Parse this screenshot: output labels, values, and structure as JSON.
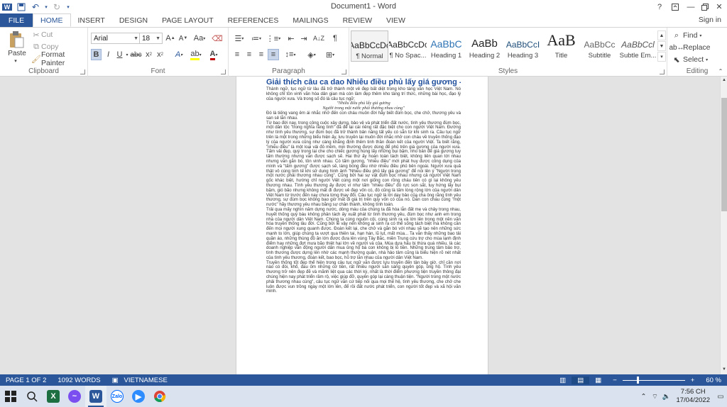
{
  "app": {
    "title": "Document1 - Word",
    "signin": "Sign in"
  },
  "tabs": [
    "FILE",
    "HOME",
    "INSERT",
    "DESIGN",
    "PAGE LAYOUT",
    "REFERENCES",
    "MAILINGS",
    "REVIEW",
    "VIEW"
  ],
  "clipboard": {
    "paste": "Paste",
    "cut": "Cut",
    "copy": "Copy",
    "format_painter": "Format Painter",
    "label": "Clipboard"
  },
  "font": {
    "name": "Arial",
    "size": "18",
    "label": "Font"
  },
  "paragraph": {
    "label": "Paragraph"
  },
  "styles": {
    "label": "Styles",
    "items": [
      {
        "preview": "AaBbCcDc",
        "name": "¶ Normal"
      },
      {
        "preview": "AaBbCcDc",
        "name": "¶ No Spac..."
      },
      {
        "preview": "AaBbC",
        "name": "Heading 1"
      },
      {
        "preview": "AaBb",
        "name": "Heading 2"
      },
      {
        "preview": "AaBbCcI",
        "name": "Heading 3"
      },
      {
        "preview": "AaB",
        "name": "Title"
      },
      {
        "preview": "AaBbCc",
        "name": "Subtitle"
      },
      {
        "preview": "AaBbCcl",
        "name": "Subtle Em..."
      }
    ]
  },
  "editing": {
    "find": "Find",
    "replace": "Replace",
    "select": "Select",
    "label": "Editing"
  },
  "document": {
    "heading": "Giải thích câu ca dao Nhiễu điều phủ lấy giá gương -",
    "intro": "Thành ngữ, tục ngữ từ lâu đã trở thành một vẻ đẹp bất diệt trong kho tàng văn học Việt Nam. Nó không chỉ tồn vinh văn hóa dân gian mà còn làm đẹp thêm kho tàng trí thức, những bài học, đạo lý của người xưa. Và trong số đó là câu tục ngữ:",
    "poem1": "\"Nhiễu điều phủ lấy giá gương",
    "poem2": "Người trong một nước phải thương nhau cùng\"",
    "p1": "Đó là tiếng vang êm ái nhắc nhở đến con cháu muôn đời hãy biết đùm bọc, che chở, thương yêu và san sẻ lẫn nhau.",
    "p2": "Từ bao đời nay, trong công cuộc xây dựng, bảo vệ và phát triển đất nước, tình yêu thương đùm bọc, một dân tộc \"trong nghĩa rằng tình\" đã để lại cái riêng rất đặc biệt cho con người Việt Nam. Đường như tình yêu thương, sự đùm bọc đã trở thành bản năng tất yếu có sẵn từ khi sinh ra. Câu tục ngữ trên là một trong những biểu hiện ấy, lưu truyền lại muôn đời nhắc nhở con cháu về truyền thống đạo lý của người xưa cũng như càng khẳng định thêm tinh thần đoàn kết của người Việt. Ta biết rằng, \"nhiễu điều\" là một loại vải đỏ mềm, mịn thường được dùng để phủ trên giá gương của người xưa. Tấm vải đẹp, quý trong lại che cho chiếc gương hùng lấy những bụi bặm, nho bản để giá gương tuy tấm thường nhưng vẫn được sạch sẽ. Hai thứ ấy hoàn toàn tách biệt, không liên quan tới nhau nhưng vẫn gắn bó, tôn vinh nhau. Có tấm gương, \"nhiễu điều\" mới phát huy được công dụng của mình và \"tấm gương\" được sạch sẽ, láng bóng đều nhờ nhiễu điều phủ bên ngoài. Người xưa quả thật vô cùng tinh tế khi sử dụng hình ảnh \"Nhiễu điều phủ lấy giá gương\" để nói lên ý \"Người trong một nước phải thương nhau cùng\". Cũng bởi hai sự vật đùm bọc nhau nhưng cả người Việt Nam gốc khác biệt, hướng chỉ người Việt cùng một nơi giống con rồng cháu tiên có gì lại không yêu thương nhau. Tình yêu thương ấy được ví như tấm \"nhiễu điều\" đỏ rực son sắt, tuy hứng lấy bụi bặm, gió bão nhưng không mất đi được vẻ đẹp vốn có, đó cũng là tấm lòng rộng lớn của người dân Việt Nam từ trước đến nay chưa từng thay đổi. Câu tục ngữ là lời dạy bảo của cha ông rằng tình yêu thương, sự đùm bọc không bao giờ mất đi giá trị trên quy vốn có của nó. Dẫn con cháu cùng \"một nước\" hãy thương yêu nhau bằng sự chân thành, không tính toán.",
    "p3": "Trải qua mấy nghìn năm dựng nước, dòng máu của chúng ta đã hòa lẫn đất mẹ và chảy trong nhau, huyết thống quý báu không phân tách ấy xuất phát từ tình thương yêu, đùm bọc như anh em trong nhà của người dân Việt Nam. Chúng ta cùng nguồn cội, cùng sinh ra và lớn lên trong một nền văn hóa truyền thống lâu đời. Cũng bởi lẽ vậy nên không ai sinh ra có thể sống tách biệt mà không cần đến mọi người xung quanh được. Đoàn kết lại, che chở và gắn bó với nhau sẽ tạo nên những sức mạnh to lớn, giúp chúng ta vượt qua thiên tai, hạn hán, lũ lụt, mất mùa... Ta vẫn thấy những bao tải quần áo, những thùng đồ ăn lớn được đưa lên vùng Tây Bắc, miền Trung cứu trợ cho mùa lạnh định điểm hay những đợt mưa bão thiệt hại lớn về người và của. Mùa dưa hấu bị thừa quá nhiều, là các doanh nghiệp vẫn động người dân mua ủng hộ bà con không bị lỗ tiền. Những trung tâm bảo trợ, tình thương được dựng lên nhờ các mạnh thường quân, nhà hảo tâm cũng là biểu hiện rõ nét nhất của tình yêu thương, đoàn kết, bao bọc, hỗ trợ lẫn nhau của người dân Việt Nam.",
    "p4": "Truyền thống tốt đẹp thể hiện trong câu tục ngữ vẫn được lưu truyền đến tận bây giờ, chỉ cần nơi nào có đói, khổ, đau ốm những cơ tiền, rất nhiều người sẵn sàng quyên góp, ủng hộ. Tình yêu thương trở nên đẹp đẽ và mãnh liệt qua các thời kỳ, nhất là thời điểm phương tiện truyền thông đại chúng hiện nay phát triển rầm rộ, việc giúp đỡ, quyên góp lại càng thuận tiện. \"Người trong một nước phải thương nhau cùng\", câu tục ngữ vẫn cứ tiếp nối qua mọi thế hệ, tình yêu thương, che chở che luôn được vun trồng ngày một lớn lên, để rồi đất nước phát triển, con người tốt đẹp và xã hội văn minh."
  },
  "status": {
    "page": "PAGE 1 OF 2",
    "words": "1092 WORDS",
    "lang": "VIETNAMESE",
    "zoom": "60 %"
  },
  "taskbar": {
    "time": "7:56 CH",
    "date": "17/04/2022"
  },
  "colors": {
    "accent": "#2b579a",
    "heading": "#1f4e9c"
  }
}
